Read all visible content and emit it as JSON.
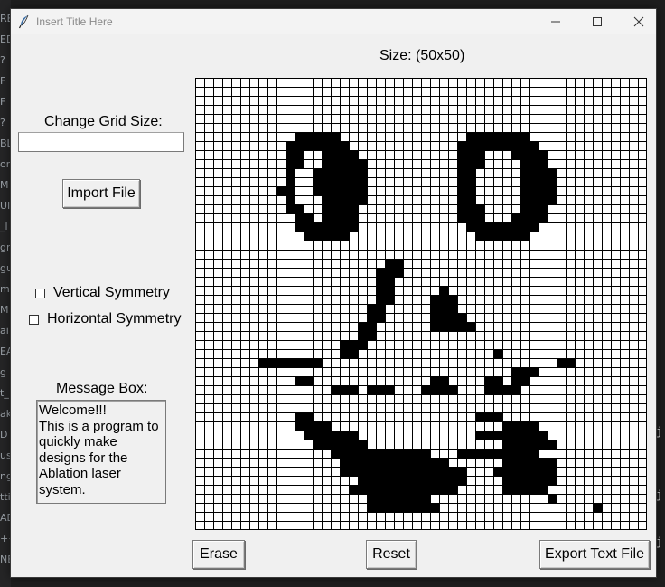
{
  "window": {
    "title": "Insert Title Here",
    "minimize_glyph": "—",
    "maximize_glyph": "☐",
    "close_glyph": "✕"
  },
  "grid": {
    "size_label": "Size: (50x50)",
    "rows": 50,
    "cols": 50,
    "cell_color": "#ffffff",
    "fill_color": "#000000",
    "line_color": "#000000",
    "pixels": [
      "..................................................",
      "..................................................",
      "..................................................",
      "..................................................",
      "..................................................",
      "..................................................",
      "...........#####..............#######.............",
      "..........#######............#########............",
      "..........##..####...........###...####...........",
      "..........##..#####..........###....###...........",
      "..........#..######..........##.....####..........",
      "..........#..######..........##.....####..........",
      ".........##..######..........##.....####..........",
      "..........#...#####..........##.....####..........",
      "..........##..####...........###....###...........",
      "...........##.####...........###...####...........",
      "...........#######............########............",
      "............#####..............######.............",
      "..................................................",
      "..................................................",
      ".....................##...........................",
      "....................###...........................",
      "....................##...........................",
      "....................##.....#......................",
      "....................##....###.....................",
      "...................##.....###.....................",
      "...................##.....####....................",
      "..................##......#####...................",
      "..................##..............................",
      "................###..............................",
      "................##...............#................",
      ".......#######..........................##........",
      "...................................###...........",
      "...........##.............##....##.##.............",
      "...............###.###...####...####..............",
      "..................................................",
      "..................................................",
      "...........##..................###...............",
      "...........####...................####..........",
      "............######.............########.........",
      ".............######...............######.........",
      "...............###########...#########...........",
      "................############......######.........",
      "................##############...#######.........",
      "..................############....######.........",
      ".................############.....#####..........",
      "...................#######.............#..........",
      "...................########.................#....",
      "..................................................",
      ".................................................."
    ]
  },
  "sidebar": {
    "grid_size_label": "Change Grid Size:",
    "grid_size_value": "",
    "import_button": "Import File",
    "vertical_symmetry": {
      "label": "Vertical Symmetry",
      "checked": false
    },
    "horizontal_symmetry": {
      "label": "Horizontal Symmetry",
      "checked": false
    },
    "message_label": "Message Box:",
    "message_text": "Welcome!!!\nThis is a program to quickly make designs for the Ablation laser system."
  },
  "bottom_bar": {
    "erase_button": "Erase",
    "reset_button": "Reset",
    "export_button": "Export Text File"
  },
  "desktop": {
    "left_strip_fragments": [
      "RE",
      "ED",
      "?",
      "F",
      "F",
      "?",
      "BL",
      "on",
      "M",
      "UI",
      "_l",
      "gr",
      "gu",
      "ma",
      "M",
      "ai",
      "EA",
      "g",
      "t_",
      "ak",
      "D",
      "us",
      "ng",
      "tti",
      "AD",
      "++",
      "NE"
    ],
    "right_strip_fragments": [
      "j",
      "j",
      "j"
    ]
  }
}
